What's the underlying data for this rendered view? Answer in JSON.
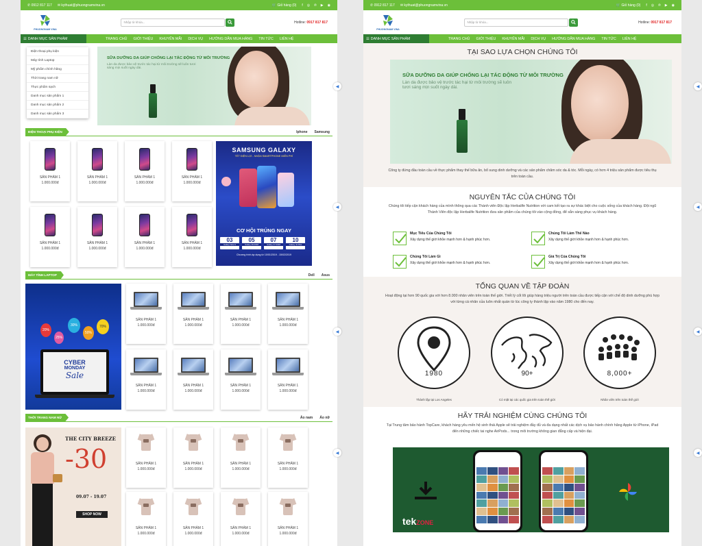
{
  "topbar": {
    "phone": "0912 817 117",
    "email": "kythuat@phuongnamvina.vn",
    "cart": "Giỏ hàng (0)"
  },
  "brand": {
    "logo_text": "PHUONGNAM VINA",
    "accent": "#6cbf3a",
    "dark_green": "#2e7d32"
  },
  "search": {
    "placeholder": "Nhập từ khóa..."
  },
  "hotline": {
    "label": "Hotline:",
    "number": "0917 817 817"
  },
  "nav": {
    "category_label": "DANH MỤC SẢN PHẨM",
    "items": [
      "TRANG CHỦ",
      "GIỚI THIỆU",
      "KHUYẾN MÃI",
      "DỊCH VỤ",
      "HƯỚNG DẪN MUA HÀNG",
      "TIN TỨC",
      "LIÊN HỆ"
    ]
  },
  "category_menu": [
    "Điện thoại phụ kiện",
    "Máy tính Laptop",
    "Mỹ phẩm chính hãng",
    "Thời trang nam nữ",
    "Thực phẩm sạch",
    "Danh mục sản phẩm 1",
    "Danh mục sản phẩm 2",
    "Danh mục sản phẩm 3"
  ],
  "banner": {
    "headline": "SỮA DƯỠNG DA GIÚP CHỐNG LẠI TÁC ĐỘNG TỪ MÔI TRƯỜNG",
    "sub": "Làn da được bảo vệ trước tác hại từ môi trường sẽ luôn tươi sáng mịn suốt ngày dài."
  },
  "product": {
    "name": "SẢN PHẨM 1",
    "price": "1.000.000đ"
  },
  "sections": [
    {
      "title": "ĐIỆN THOẠI PHỤ KIỆN",
      "subs": [
        "Iphone",
        "Samsung"
      ]
    },
    {
      "title": "MÁY TÍNH LAPTOP",
      "subs": [
        "Dell",
        "Asus"
      ]
    },
    {
      "title": "THỜI TRANG NAM NỮ",
      "subs": [
        "Áo nam",
        "Áo nữ"
      ]
    }
  ],
  "samsung_ad": {
    "title": "SAMSUNG GALAXY",
    "sub": "TẾT ĐIỆN LỢI - NHẬN SMARTPHONE MIỄN PHÍ",
    "cta": "CƠ HỘI TRÚNG NGAY",
    "dates": [
      "03",
      "05",
      "07",
      "10"
    ],
    "prizes": [
      "Galaxy Note 9",
      "Galaxy A9 2018",
      "Galaxy A7 2018",
      "Galaxy J4 Plus"
    ],
    "period": "Chương trình áp dụng từ 10/01/2019 - 15/02/2019"
  },
  "cyber_ad": {
    "line1": "CYBER",
    "line2": "MONDAY",
    "line3": "Sale",
    "balloons": [
      "20%",
      "30%",
      "50%",
      "70%",
      "25%"
    ]
  },
  "fashion_ad": {
    "title": "THE CITY BREEZE",
    "discount": "-30",
    "dates": "09.07 - 19.07",
    "cta": "SHOP NOW"
  },
  "about": {
    "why_title": "TẠI SAO LỰA CHỌN CHÚNG TÔI",
    "why_text": "Công ty đứng đầu toàn cầu về thực phẩm thay thế bữa ăn, bổ sung dinh dưỡng và các sản phẩm chăm sóc da & tóc. Mỗi ngày, có hơn 4 triệu sản phẩm được tiêu thụ trên toàn cầu.",
    "principles_title": "NGUYÊN TẮC CỦA CHÚNG TÔI",
    "principles_text": "Chúng tôi tiếp cận khách hàng của mình thông qua các Thành viên Độc lập Herbalife Nutrition với cam kết tạo ra sự khác biệt cho cuộc sống của khách hàng. Đội ngũ Thành Viên độc lập Herbalife Nutrition đưa sản phẩm của chúng tôi vào cộng đồng, để sẵn sàng phục vụ khách hàng.",
    "features": [
      {
        "title": "Mục Tiêu Của Chúng Tôi",
        "text": "Xây dựng thế giới khỏe mạnh hơn & hạnh phúc hơn."
      },
      {
        "title": "Chúng Tôi Làm Thế Nào",
        "text": "Xây dựng thế giới khỏe mạnh hơn & hạnh phúc hơn."
      },
      {
        "title": "Chúng Tôi Làm Gì",
        "text": "Xây dựng thế giới khỏe mạnh hơn & hạnh phúc hơn."
      },
      {
        "title": "Giá Trị Của Chúng Tôi",
        "text": "Xây dựng thế giới khỏe mạnh hơn & hạnh phúc hơn."
      }
    ],
    "overview_title": "TỔNG QUAN VỀ TẬP ĐOÀN",
    "overview_text": "Hoạt động tại hơn 90 quốc gia với hơn 8.000 nhân viên trên toàn thế giới. Triết lý cốt lõi giúp hàng triệu người trên toàn cầu được tiếp cận với chế độ dinh dưỡng phù hợp với từng cá nhân của luôn nhất quán từ lúc công ty thành lập vào năm 1980 cho đến nay.",
    "stats": [
      {
        "value": "1980",
        "label": "Thành lập tại Los Angeles"
      },
      {
        "value": "90+",
        "label": "Có mặt tại các quốc gia trên toàn thế giới"
      },
      {
        "value": "8,000+",
        "label": "Nhân viên trên toàn thế giới"
      }
    ],
    "experience_title": "HÃY TRẢI NGHIỆM CÙNG CHÚNG TÔI",
    "experience_text": "Tại Trung tâm bảo hành TopCare, khách hàng yêu mến hệ sinh thái Apple sẽ trải nghiệm đầy đủ và đa dạng nhất các dịch vụ bảo hành chính hãng Apple từ iPhone, iPad đến những chiếc tai nghe AirPods... trong môi trường không gian đẳng cấp và hiện đại.",
    "video_brand_a": "tek",
    "video_brand_b": "ZONE"
  }
}
